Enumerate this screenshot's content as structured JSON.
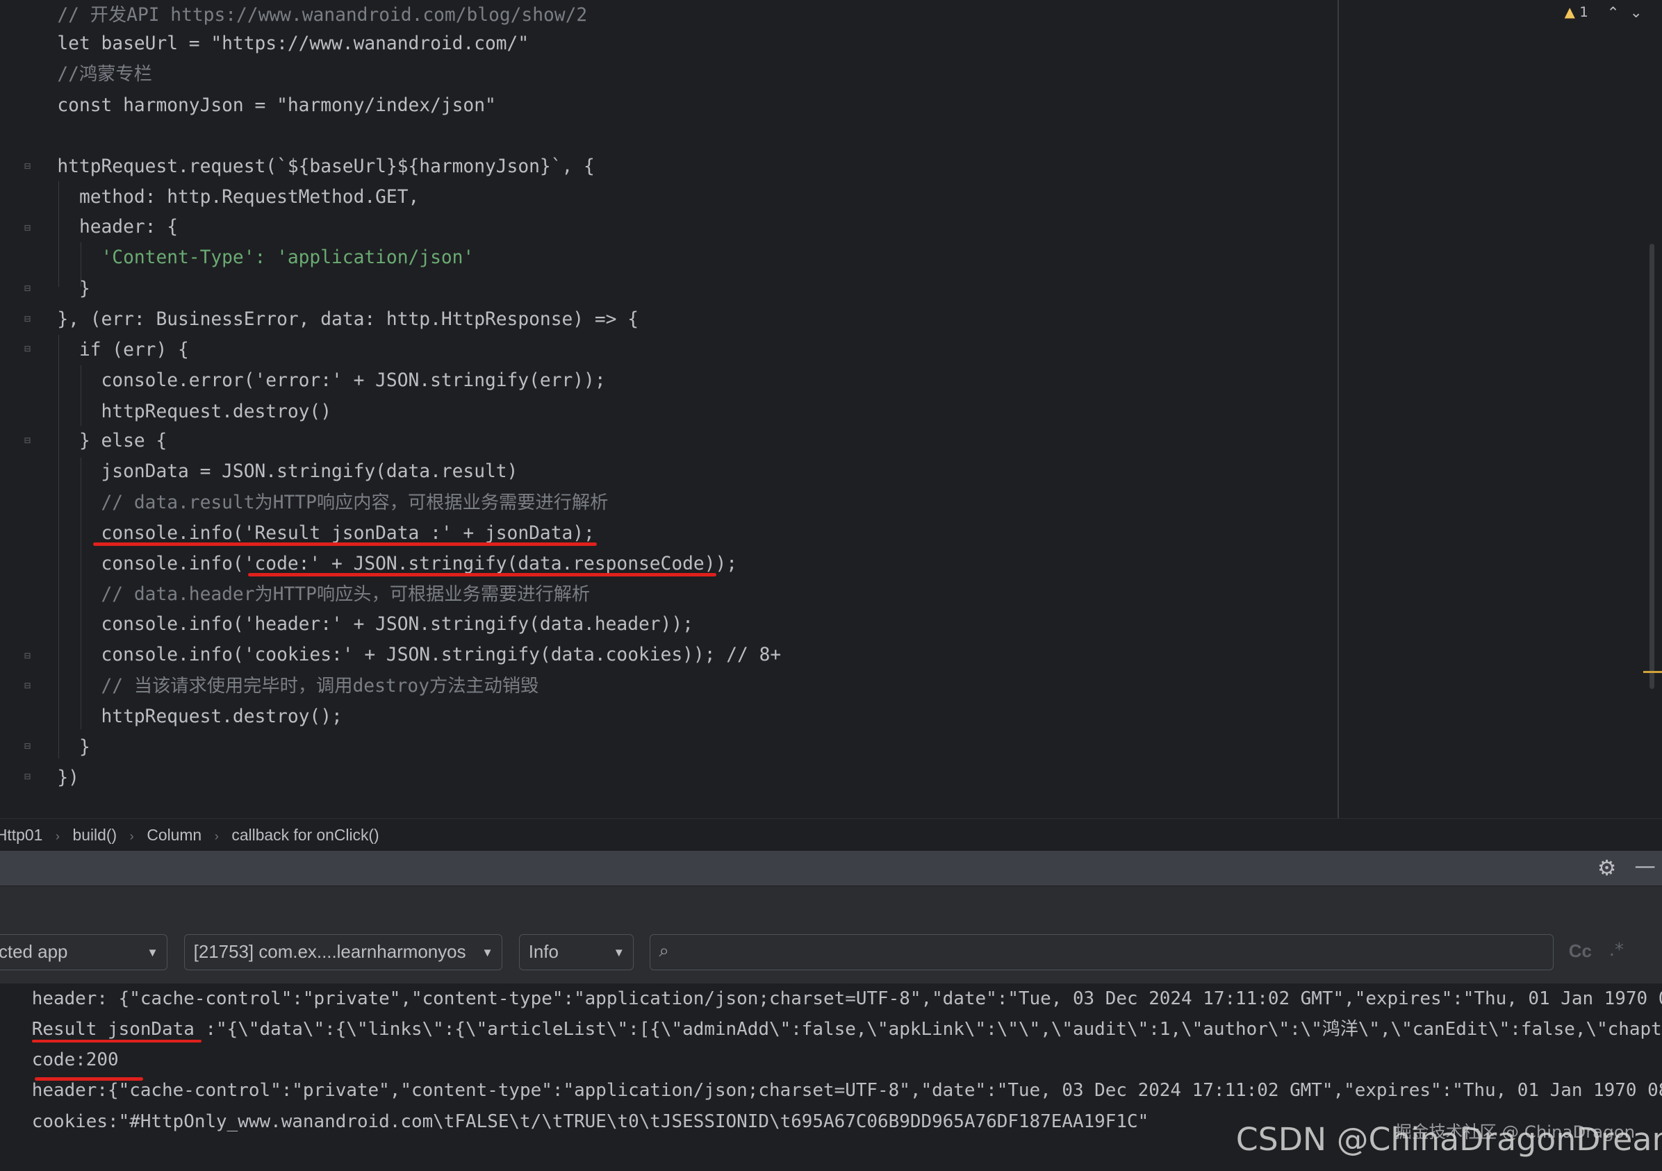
{
  "editor": {
    "lines": [
      "// 开发API https://www.wanandroid.com/blog/show/2",
      "let baseUrl = \"https://www.wanandroid.com/\"",
      "//鸿蒙专栏",
      "const harmonyJson = \"harmony/index/json\"",
      "",
      "httpRequest.request(`${baseUrl}${harmonyJson}`, {",
      "  method: http.RequestMethod.GET,",
      "  header: {",
      "    'Content-Type': 'application/json'",
      "  }",
      "}, (err: BusinessError, data: http.HttpResponse) => {",
      "  if (err) {",
      "    console.error('error:' + JSON.stringify(err));",
      "    httpRequest.destroy()",
      "  } else {",
      "    jsonData = JSON.stringify(data.result)",
      "    // data.result为HTTP响应内容，可根据业务需要进行解析",
      "    console.info('Result jsonData :' + jsonData);",
      "    console.info('code:' + JSON.stringify(data.responseCode));",
      "    // data.header为HTTP响应头，可根据业务需要进行解析",
      "    console.info('header:' + JSON.stringify(data.header));",
      "    console.info('cookies:' + JSON.stringify(data.cookies)); // 8+",
      "    // 当该请求使用完毕时，调用destroy方法主动销毁",
      "    httpRequest.destroy();",
      "  }",
      "})"
    ],
    "inspection_count": "1"
  },
  "breadcrumb": [
    "Http01",
    "build()",
    "Column",
    "callback for onClick()"
  ],
  "filters": {
    "process": "[21753] com.ex....learnharmonyos",
    "device": "cted app",
    "level": "Info",
    "search_value": "",
    "case_label": "Cc",
    "regex_label": ".*"
  },
  "log": {
    "lines": [
      "header: {\"cache-control\":\"private\",\"content-type\":\"application/json;charset=UTF-8\",\"date\":\"Tue, 03 Dec 2024 17:11:02 GMT\",\"expires\":\"Thu, 01 Jan 1970 0",
      "Result jsonData :\"{\\\"data\\\":{\\\"links\\\":{\\\"articleList\\\":[{\\\"adminAdd\\\":false,\\\"apkLink\\\":\\\"\\\",\\\"audit\\\":1,\\\"author\\\":\\\"鸿洋\\\",\\\"canEdit\\\":false,\\\"chapt",
      "code:200",
      "header:{\"cache-control\":\"private\",\"content-type\":\"application/json;charset=UTF-8\",\"date\":\"Tue, 03 Dec 2024 17:11:02 GMT\",\"expires\":\"Thu, 01 Jan 1970 08",
      "cookies:\"#HttpOnly_www.wanandroid.com\\tFALSE\\t/\\tTRUE\\t0\\tJSESSIONID\\t695A67C06B9DD965A76DF187EAA19F1C\""
    ]
  },
  "watermark": {
    "small": "掘金技术社区 @ ChinaDragon",
    "large": "CSDN @ChinaDragonDreamer"
  }
}
